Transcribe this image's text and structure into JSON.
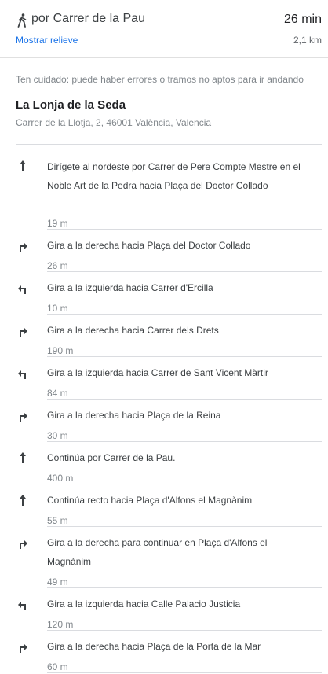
{
  "header": {
    "title": "por Carrer de la Pau",
    "duration": "26 min",
    "relief_link": "Mostrar relieve",
    "distance": "2,1 km"
  },
  "warning": "Ten cuidado: puede haber errores o tramos no aptos para ir andando",
  "origin": {
    "name": "La Lonja de la Seda",
    "address": "Carrer de la Llotja, 2, 46001 València, Valencia"
  },
  "steps": [
    {
      "icon": "arrow-up-icon",
      "text": "Dirígete al nordeste por Carrer de Pere Compte Mestre en el Noble Art de la Pedra hacia Plaça del Doctor Collado",
      "distance": "19 m"
    },
    {
      "icon": "turn-right-icon",
      "text": "Gira a la derecha hacia Plaça del Doctor Collado",
      "distance": "26 m"
    },
    {
      "icon": "turn-left-icon",
      "text": "Gira a la izquierda hacia Carrer d'Ercilla",
      "distance": "10 m"
    },
    {
      "icon": "turn-right-icon",
      "text": "Gira a la derecha hacia Carrer dels Drets",
      "distance": "190 m"
    },
    {
      "icon": "turn-left-icon",
      "text": "Gira a la izquierda hacia Carrer de Sant Vicent Màrtir",
      "distance": "84 m"
    },
    {
      "icon": "turn-right-icon",
      "text": "Gira a la derecha hacia Plaça de la Reina",
      "distance": "30 m"
    },
    {
      "icon": "arrow-up-icon",
      "text": "Continúa por Carrer de la Pau.",
      "distance": "400 m"
    },
    {
      "icon": "arrow-up-icon",
      "text": "Continúa recto hacia Plaça d'Alfons el Magnànim",
      "distance": "55 m"
    },
    {
      "icon": "turn-right-icon",
      "text": "Gira a la derecha para continuar en Plaça d'Alfons el Magnànim",
      "distance": "49 m"
    },
    {
      "icon": "turn-left-icon",
      "text": "Gira a la izquierda hacia Calle Palacio Justicia",
      "distance": "120 m"
    },
    {
      "icon": "turn-right-icon",
      "text": "Gira a la derecha hacia Plaça de la Porta de la Mar",
      "distance": "60 m"
    }
  ]
}
